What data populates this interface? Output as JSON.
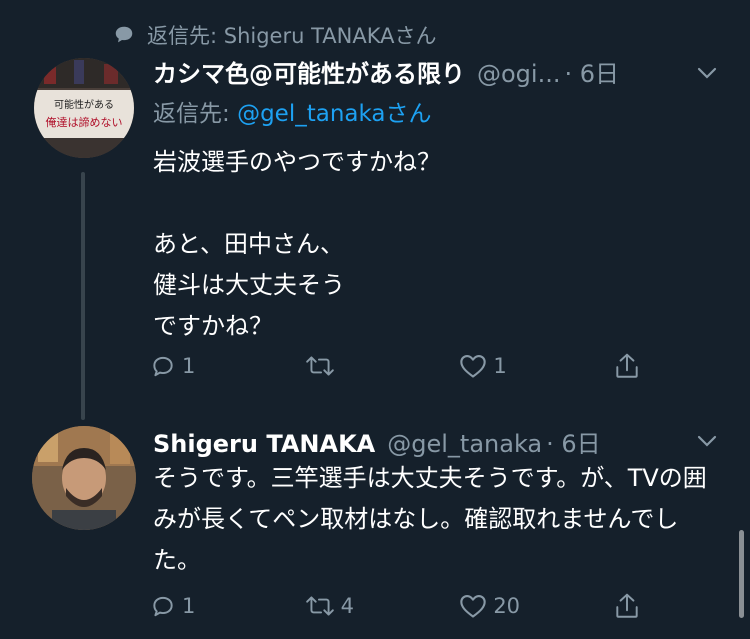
{
  "reply_context": {
    "text": "返信先: Shigeru TANAKAさん"
  },
  "tweets": [
    {
      "display_name": "カシマ色@可能性がある限り",
      "handle": "@ogi...",
      "time": "· 6日",
      "reply_to_prefix": "返信先: ",
      "reply_to_handle": "@gel_tanaka",
      "reply_to_suffix": "さん",
      "avatar_banner_text": "可能性がある限り 俺達は諦めない",
      "text": "岩波選手のやつですかね？\n\nあと、田中さん、\n健斗は大丈夫そう\nですかね？",
      "actions": {
        "reply": "1",
        "retweet": "",
        "like": "1"
      }
    },
    {
      "display_name": "Shigeru TANAKA",
      "handle": "@gel_tanaka",
      "time": "· 6日",
      "text": "そうです。三竿選手は大丈夫そうです。が、TVの囲みが長くてペン取材はなし。確認取れませんでした。",
      "actions": {
        "reply": "1",
        "retweet": "4",
        "like": "20"
      }
    }
  ],
  "colors": {
    "background": "#15202b",
    "muted": "#8899a6",
    "link": "#1da1f2",
    "text": "#ffffff"
  },
  "icons": [
    "speech-bubble-icon",
    "reply-icon",
    "retweet-icon",
    "like-icon",
    "share-icon",
    "chevron-down-icon"
  ]
}
